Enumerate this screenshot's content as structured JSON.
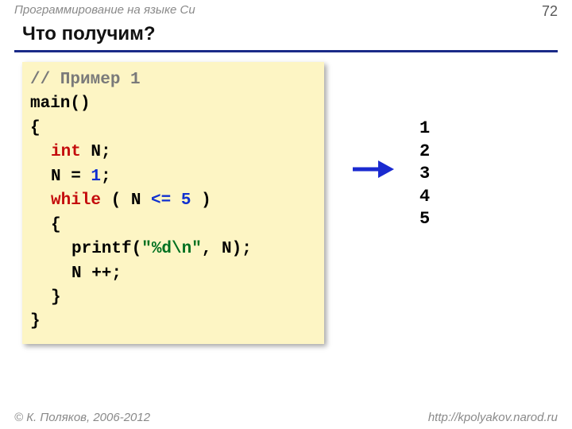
{
  "header": {
    "subject": "Программирование на языке Си",
    "page": "72"
  },
  "title": "Что получим?",
  "code": {
    "comment": "// Пример 1",
    "l2": "main()",
    "l3": "{",
    "kwInt": "int",
    "declRest": " N;",
    "assignLhs": "N = ",
    "one": "1",
    "assignEnd": ";",
    "kwWhile": "while",
    "condPre": " ( N ",
    "leq": "<=",
    "space": " ",
    "five": "5",
    "condPost": " )",
    "l7": "{",
    "printfName": "printf(",
    "printfStr": "\"%d\\n\"",
    "printfRest": ", N);",
    "inc": "N ++;",
    "l10": "}",
    "l11": "}"
  },
  "output": "1\n2\n3\n4\n5",
  "footer": {
    "copyright": "© К. Поляков, 2006-2012",
    "url": "http://kpolyakov.narod.ru"
  }
}
